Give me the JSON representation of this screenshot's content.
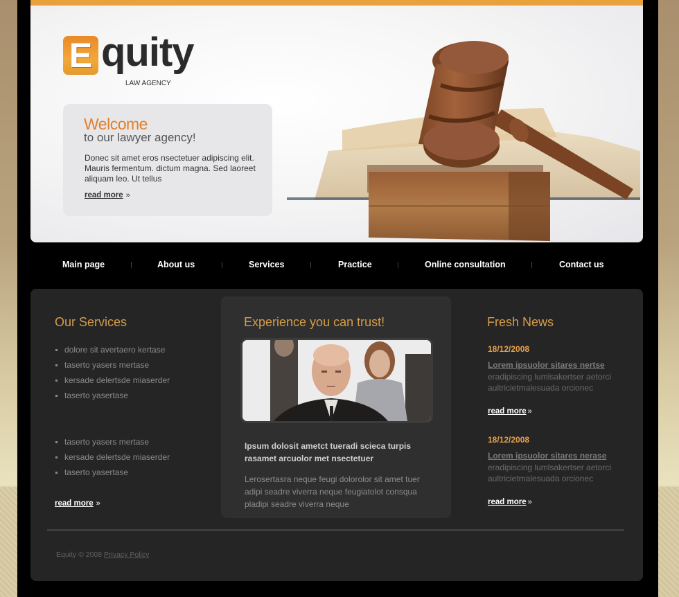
{
  "brand": {
    "logo_letter": "E",
    "logo_rest": "quity",
    "tagline": "LAW AGENCY",
    "accent_color": "#e9a13b",
    "heading_color": "#d69d4a"
  },
  "welcome": {
    "title": "Welcome",
    "subtitle": "to our lawyer agency!",
    "text": "Donec sit amet eros nsectetuer adipiscing elit. Mauris fermentum. dictum magna. Sed laoreet aliquam leo. Ut tellus",
    "read_more": "read more",
    "arrow": "»"
  },
  "hero_image": "gavel-on-books",
  "nav": {
    "items": [
      {
        "label": "Main page"
      },
      {
        "label": "About us"
      },
      {
        "label": "Services"
      },
      {
        "label": "Practice"
      },
      {
        "label": "Online consultation"
      },
      {
        "label": "Contact us"
      }
    ]
  },
  "services": {
    "title": "Our Services",
    "list_a": [
      "dolore sit avertaero kertase",
      "taserto yasers mertase",
      "kersade delertsde miaserder",
      "taserto yasertase"
    ],
    "list_b": [
      "taserto yasers mertase",
      "kersade delertsde miaserder",
      "taserto yasertase"
    ],
    "read_more": "read more",
    "arrow": "»"
  },
  "experience": {
    "title": "Experience you can trust!",
    "photo": "business-people-portrait",
    "bold_text": "Ipsum dolosit ametct tueradi scieca turpis rasamet arcuolor met nsectetuer",
    "text": "Lerosertasra neque feugi dolorolor sit amet tuer adipi seadre viverra neque feugiatolot consqua pladipi seadre viverra neque"
  },
  "news": {
    "title": "Fresh News",
    "items": [
      {
        "date": "18/12/2008",
        "headline": "Lorem ipsuolor sitares nertse",
        "text": "eradipiscing  lumlsakertser aetorci aultricietmalesuada orcionec",
        "read_more": "read more",
        "arrow": "»"
      },
      {
        "date": "18/12/2008",
        "headline": "Lorem ipsuolor sitares nerase",
        "text": "eradipiscing  lumlsakertser aetorci aultricietmalesuada orcionec",
        "read_more": "read more",
        "arrow": "»"
      }
    ]
  },
  "footer": {
    "copyright": "Equity © 2008",
    "privacy": "Privacy Policy"
  }
}
